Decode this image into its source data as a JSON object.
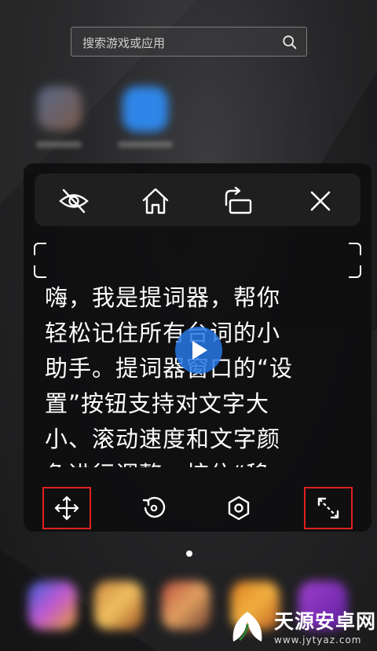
{
  "search": {
    "placeholder": "搜索游戏或应用",
    "icon": "search-icon"
  },
  "toolbar": {
    "icons": [
      "hide-eye-icon",
      "home-icon",
      "rotate-screen-icon",
      "close-icon"
    ]
  },
  "teleprompter": {
    "text": "嗨，我是提词器，帮你\n轻松记住所有台词的小\n助手。提词器窗口的“设\n置”按钮支持对文字大\n小、滚动速度和文字颜\n色进行调整，按住“移",
    "play_icon": "play-icon"
  },
  "bottom_bar": {
    "icons": [
      "move-icon",
      "reset-icon",
      "settings-icon",
      "resize-icon"
    ],
    "highlight_color": "#e02020"
  },
  "page_indicator": {
    "pages": 1,
    "current": 1
  },
  "watermark": {
    "title": "天源安卓网",
    "url": "www.jytyaz.com"
  },
  "colors": {
    "accent": "#2878e6"
  }
}
